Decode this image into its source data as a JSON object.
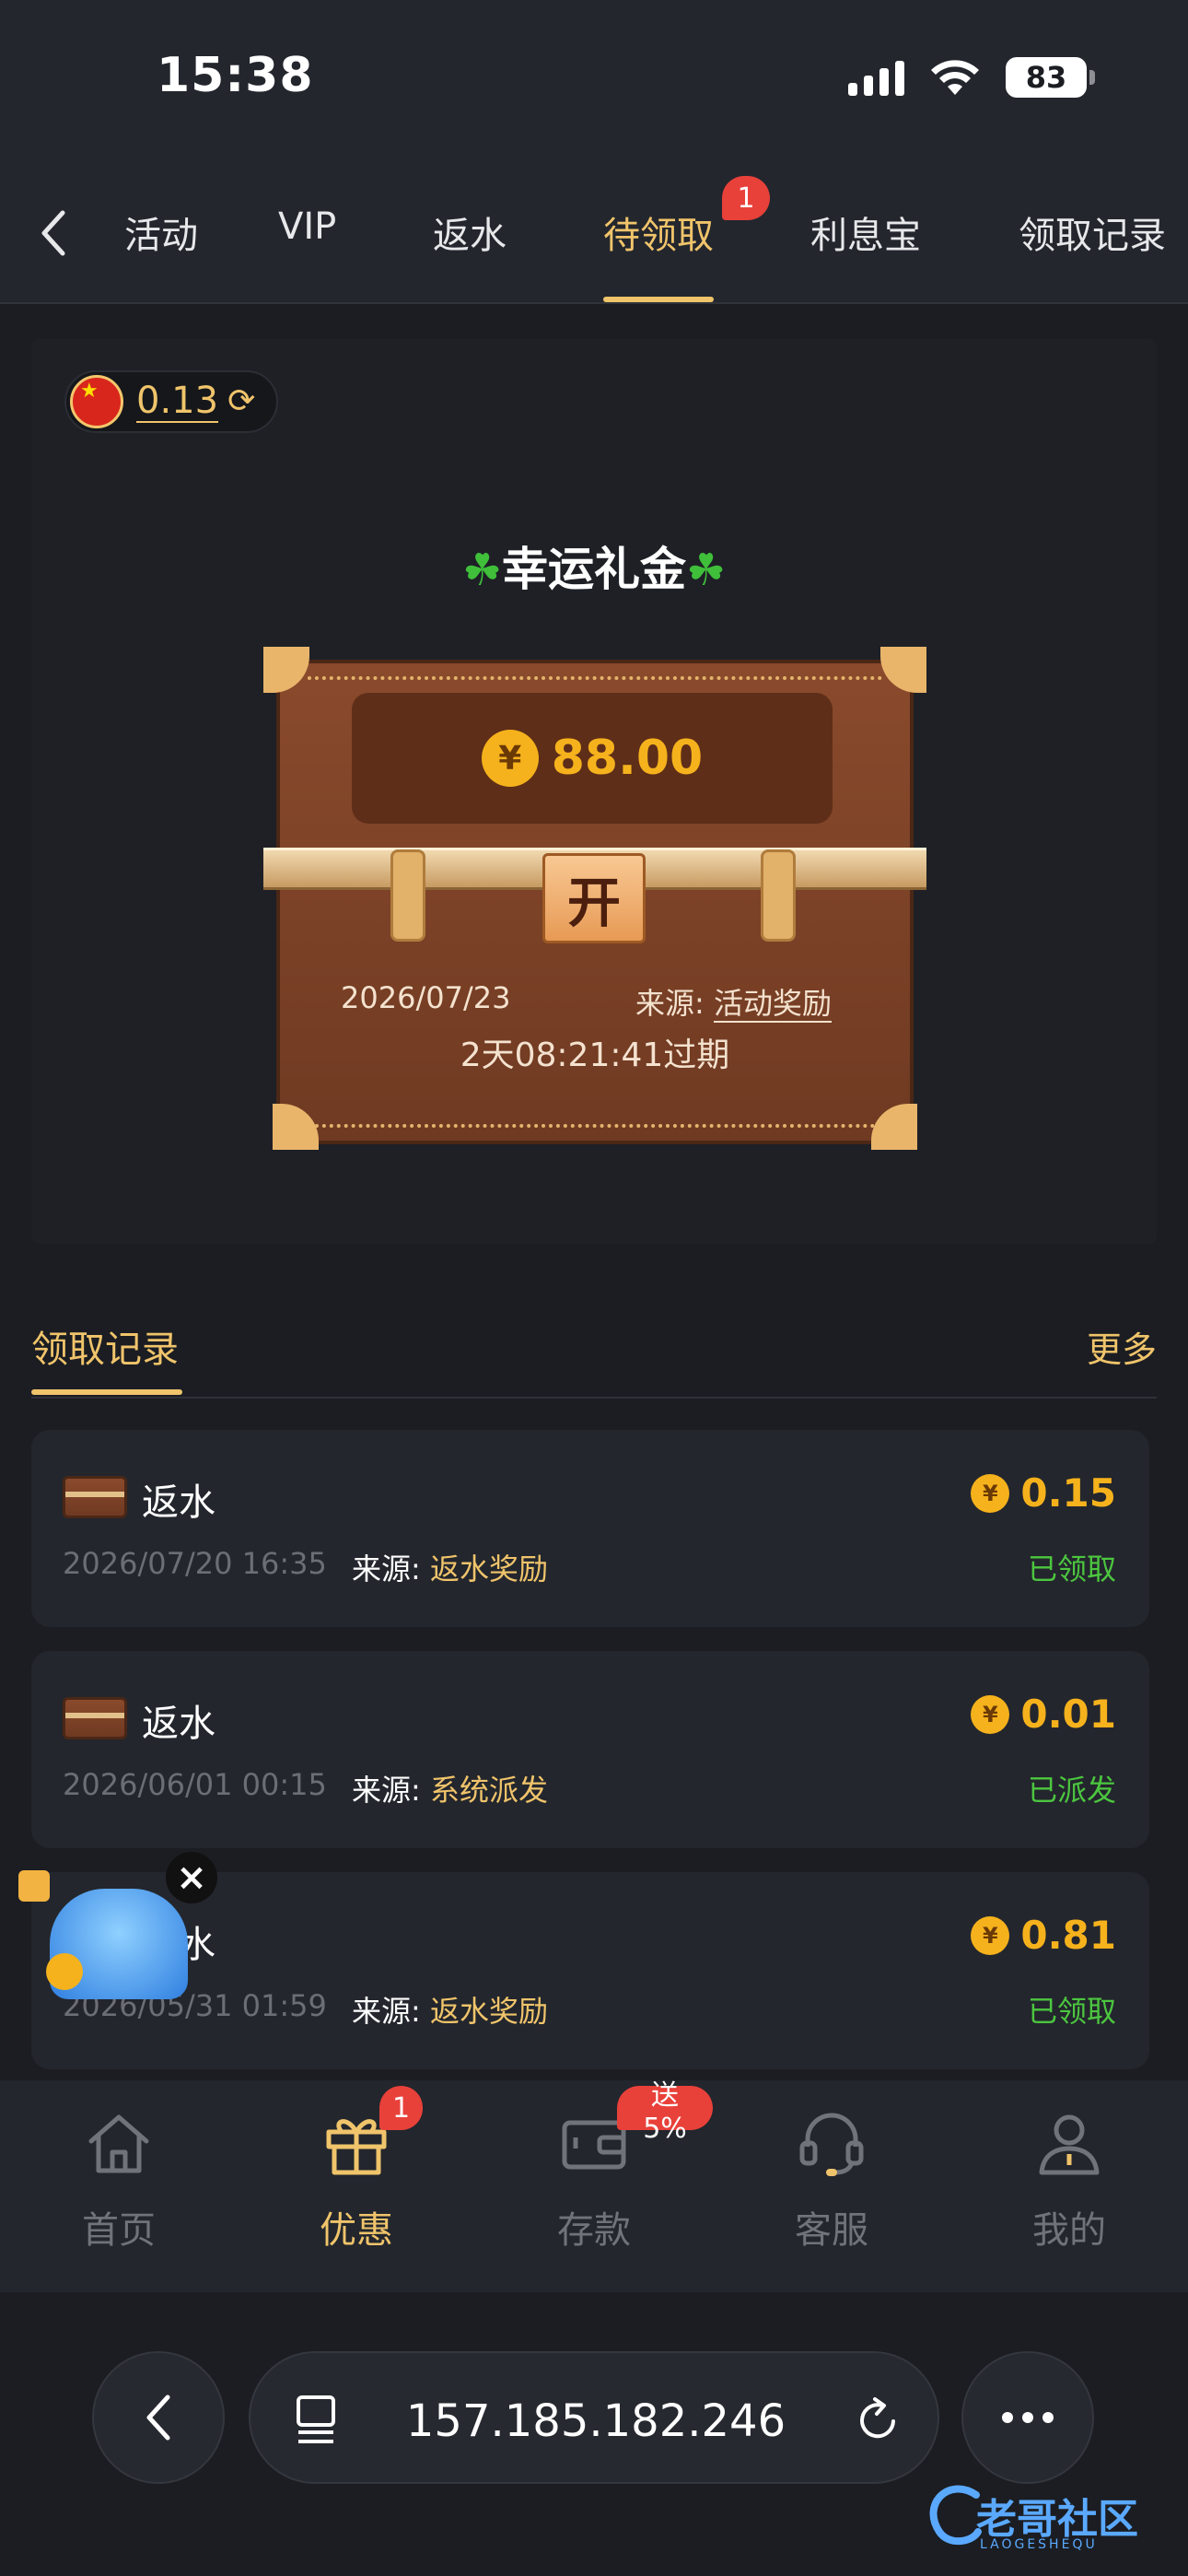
{
  "status": {
    "time": "15:38",
    "battery": "83"
  },
  "tabs": [
    {
      "label": "活动"
    },
    {
      "label": "VIP"
    },
    {
      "label": "返水"
    },
    {
      "label": "待领取",
      "badge": "1",
      "active": true
    },
    {
      "label": "利息宝"
    },
    {
      "label": "领取记录"
    }
  ],
  "balance": {
    "value": "0.13"
  },
  "gift": {
    "title": "幸运礼金",
    "currency_symbol": "¥",
    "amount": "88.00",
    "lock_label": "开",
    "date": "2026/07/23",
    "source_label": "来源:",
    "source_value": "活动奖励",
    "countdown": "2天08:21:41过期"
  },
  "records": {
    "title": "领取记录",
    "more": "更多",
    "items": [
      {
        "title": "返水",
        "date": "2026/07/20 16:35",
        "source_label": "来源:",
        "source_value": "返水奖励",
        "amount": "0.15",
        "status": "已领取"
      },
      {
        "title": "返水",
        "date": "2026/06/01 00:15",
        "source_label": "来源:",
        "source_value": "系统派发",
        "amount": "0.01",
        "status": "已派发"
      },
      {
        "title": "返水",
        "date": "2026/05/31 01:59",
        "source_label": "来源:",
        "source_value": "返水奖励",
        "amount": "0.81",
        "status": "已领取"
      }
    ]
  },
  "bottom_nav": [
    {
      "label": "首页",
      "icon": "home-icon"
    },
    {
      "label": "优惠",
      "icon": "gift-icon",
      "badge": "1",
      "active": true
    },
    {
      "label": "存款",
      "icon": "wallet-icon",
      "badge": "送5%"
    },
    {
      "label": "客服",
      "icon": "headset-icon"
    },
    {
      "label": "我的",
      "icon": "user-icon"
    }
  ],
  "browser": {
    "url": "157.185.182.246"
  },
  "watermark": {
    "text": "老哥社区",
    "sub": "LAOGESHEQU"
  },
  "colors": {
    "accent": "#f0c46b",
    "coin": "#f6b21c",
    "success": "#4cc63f",
    "badge": "#e8413a",
    "background": "#1b1d22",
    "card": "#23262d"
  }
}
